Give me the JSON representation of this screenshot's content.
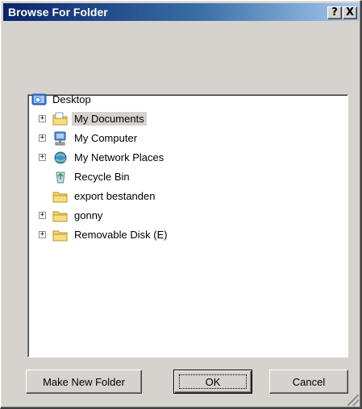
{
  "window": {
    "title": "Browse For Folder",
    "help_glyph": "?",
    "close_glyph": "X"
  },
  "tree": {
    "items": [
      {
        "label": "Desktop",
        "icon": "desktop-icon",
        "expander": ""
      },
      {
        "label": "My Documents",
        "icon": "my-documents-folder-icon",
        "expander": "+",
        "selected": true
      },
      {
        "label": "My Computer",
        "icon": "my-computer-icon",
        "expander": "+"
      },
      {
        "label": "My Network Places",
        "icon": "network-places-icon",
        "expander": "+"
      },
      {
        "label": "Recycle Bin",
        "icon": "recycle-bin-icon",
        "expander": ""
      },
      {
        "label": "export bestanden",
        "icon": "folder-icon",
        "expander": ""
      },
      {
        "label": "gonny",
        "icon": "folder-icon",
        "expander": "+"
      },
      {
        "label": "Removable Disk (E)",
        "icon": "folder-icon",
        "expander": "+"
      }
    ]
  },
  "buttons": {
    "make_new_folder": "Make New Folder",
    "ok": "OK",
    "cancel": "Cancel"
  },
  "colors": {
    "title_start": "#0a246a",
    "title_end": "#a6caf0",
    "face": "#d6d3ce",
    "folder": "#f3d36b"
  }
}
